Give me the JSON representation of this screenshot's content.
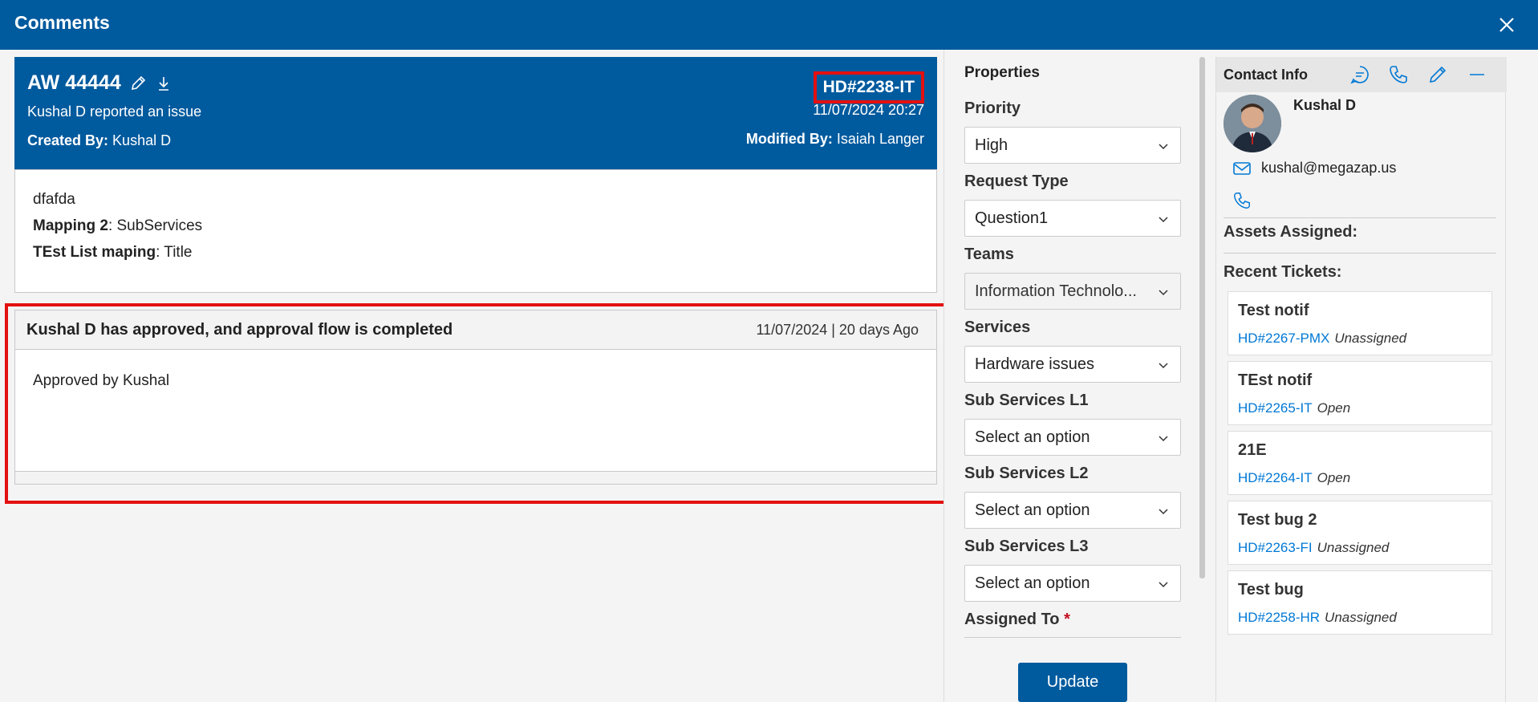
{
  "header": {
    "title": "Comments"
  },
  "ticket": {
    "title": "AW 44444",
    "subtitle": "Kushal D reported an issue",
    "created_label": "Created By:",
    "created_by": "Kushal D",
    "id": "HD#2238-IT",
    "date": "11/07/2024 20:27",
    "modified_label": "Modified By:",
    "modified_by": "Isaiah Langer"
  },
  "description": {
    "line1": "dfafda",
    "field1_label": "Mapping 2",
    "field1_value": ": SubServices",
    "field2_label": "TEst List maping",
    "field2_value": ": Title"
  },
  "approval": {
    "title": "Kushal D has approved, and approval flow is completed",
    "date": "11/07/2024 | 20 days Ago",
    "body": "Approved by Kushal"
  },
  "properties": {
    "heading": "Properties",
    "fields": [
      {
        "label": "Priority",
        "value": "High"
      },
      {
        "label": "Request Type",
        "value": "Question1"
      },
      {
        "label": "Teams",
        "value": "Information Technolo..."
      },
      {
        "label": "Services",
        "value": "Hardware issues"
      },
      {
        "label": "Sub Services L1",
        "value": "Select an option"
      },
      {
        "label": "Sub Services L2",
        "value": "Select an option"
      },
      {
        "label": "Sub Services L3",
        "value": "Select an option"
      }
    ],
    "assigned_label": "Assigned To",
    "required_mark": "*",
    "update_label": "Update"
  },
  "contact": {
    "heading": "Contact Info",
    "name": "Kushal D",
    "email": "kushal@megazap.us",
    "assets_label": "Assets Assigned:",
    "recent_label": "Recent Tickets:",
    "tickets": [
      {
        "title": "Test notif",
        "id": "HD#2267-PMX",
        "status": "Unassigned"
      },
      {
        "title": "TEst notif",
        "id": "HD#2265-IT",
        "status": "Open"
      },
      {
        "title": "21E",
        "id": "HD#2264-IT",
        "status": "Open"
      },
      {
        "title": "Test bug 2",
        "id": "HD#2263-FI",
        "status": "Unassigned"
      },
      {
        "title": "Test bug",
        "id": "HD#2258-HR",
        "status": "Unassigned"
      }
    ]
  },
  "colors": {
    "brand": "#005a9e",
    "highlight": "#e31010",
    "link": "#0078d4"
  },
  "icons": [
    "close-icon",
    "edit-icon",
    "download-icon",
    "chat-icon",
    "phone-icon",
    "mail-icon",
    "minimize-icon",
    "chevron-down-icon"
  ]
}
